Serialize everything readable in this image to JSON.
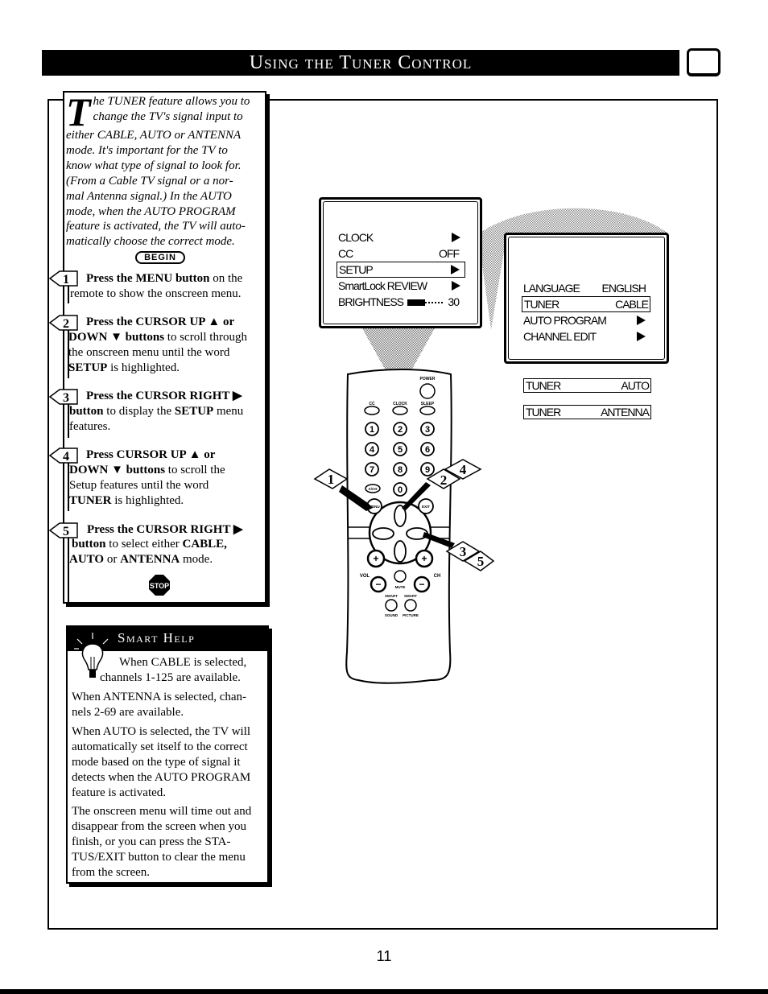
{
  "header": {
    "title": "Using the Tuner Control",
    "icon": "tv-icon"
  },
  "intro": {
    "dropcap": "T",
    "lines": [
      "he TUNER feature allows you to",
      "change the TV's signal input to",
      "either CABLE, AUTO or ANTENNA",
      "mode. It's important for the TV to",
      "know what type of signal to look for.",
      "(From a Cable TV signal or a nor-",
      "mal Antenna signal.) In the AUTO",
      "mode, when the AUTO PROGRAM",
      "feature is activated, the TV will auto-",
      "matically choose the correct mode."
    ],
    "begin_label": "BEGIN"
  },
  "steps": [
    {
      "num": "1",
      "bold1": "Press the MENU button",
      "text1": " on the",
      "line2": "remote to show the onscreen menu.",
      "line3": "",
      "line4": ""
    },
    {
      "num": "2",
      "bold1": "Press the CURSOR UP ▲ or",
      "text1": "",
      "line2_bold": "DOWN ▼ buttons",
      "line2": " to scroll through",
      "line3": "the onscreen menu until the word",
      "line4_bold": "SETUP",
      "line4": " is highlighted."
    },
    {
      "num": "3",
      "bold1": "Press the CURSOR RIGHT ▶",
      "text1": "",
      "line2_bold": "button",
      "line2": " to display the ",
      "line2_bold2": "SETUP",
      "line2_end": " menu",
      "line3": "features."
    },
    {
      "num": "4",
      "bold1": "Press CURSOR UP ▲ or",
      "text1": "",
      "line2_bold": "DOWN ▼ buttons",
      "line2": " to scroll the",
      "line3": "Setup features until the word",
      "line4_bold": "TUNER",
      "line4": " is highlighted."
    },
    {
      "num": "5",
      "bold1": "Press the CURSOR RIGHT ▶",
      "text1": "",
      "line2_bold": "button",
      "line2": " to select either ",
      "line2_bold2": "CABLE,",
      "line3_bold": "AUTO",
      "line3": " or ",
      "line3_bold2": "ANTENNA",
      "line3_end": " mode."
    }
  ],
  "stop_label": "STOP",
  "smart_help": {
    "title": "Smart Help",
    "paragraphs": [
      [
        "When CABLE is selected,",
        "channels 1-125 are available."
      ],
      [
        "When ANTENNA is selected, chan-",
        "nels 2-69 are available."
      ],
      [
        "When AUTO is selected, the TV will",
        "automatically set itself to the correct",
        "mode based on the type of signal it",
        "detects when the AUTO PROGRAM",
        "feature is activated."
      ],
      [
        "The onscreen menu will time out and",
        "disappear from the screen when you",
        "finish, or you can press the STA-",
        "TUS/EXIT button to clear the menu",
        "from the screen."
      ]
    ]
  },
  "main_menu": {
    "items": [
      {
        "label": "CLOCK",
        "value": "▶",
        "highlighted": false
      },
      {
        "label": "CC",
        "value": "OFF",
        "highlighted": false
      },
      {
        "label": "SETUP",
        "value": "▶",
        "highlighted": true
      },
      {
        "label": "SmartLock REVIEW",
        "value": "▶",
        "highlighted": false
      },
      {
        "label": "BRIGHTNESS",
        "value": "30",
        "highlighted": false
      }
    ],
    "brightness_level": 30
  },
  "setup_menu": {
    "items": [
      {
        "label": "LANGUAGE",
        "value": "ENGLISH",
        "highlighted": false
      },
      {
        "label": "TUNER",
        "value": "CABLE",
        "highlighted": true
      },
      {
        "label": "AUTO PROGRAM",
        "value": "▶",
        "highlighted": false
      },
      {
        "label": "CHANNEL EDIT",
        "value": "▶",
        "highlighted": false
      }
    ]
  },
  "tuner_options": [
    {
      "label": "TUNER",
      "value": "AUTO"
    },
    {
      "label": "TUNER",
      "value": "ANTENNA"
    }
  ],
  "remote": {
    "labels": {
      "power": "POWER",
      "cc": "CC",
      "clock": "CLOCK",
      "sleep": "SLEEP",
      "ach": "A/CH",
      "menu": "MENU",
      "exit": "EXIT",
      "vol": "VOL",
      "ch": "CH",
      "mute": "MUTE",
      "smart1": "SMART",
      "smart2": "SMART",
      "sound": "SOUND",
      "picture": "PICTURE",
      "plus": "+",
      "minus": "−"
    },
    "digits": [
      "1",
      "2",
      "3",
      "4",
      "5",
      "6",
      "7",
      "8",
      "9",
      "0"
    ],
    "callouts": [
      "1",
      "2",
      "3",
      "4",
      "5"
    ]
  },
  "page_number": "11"
}
